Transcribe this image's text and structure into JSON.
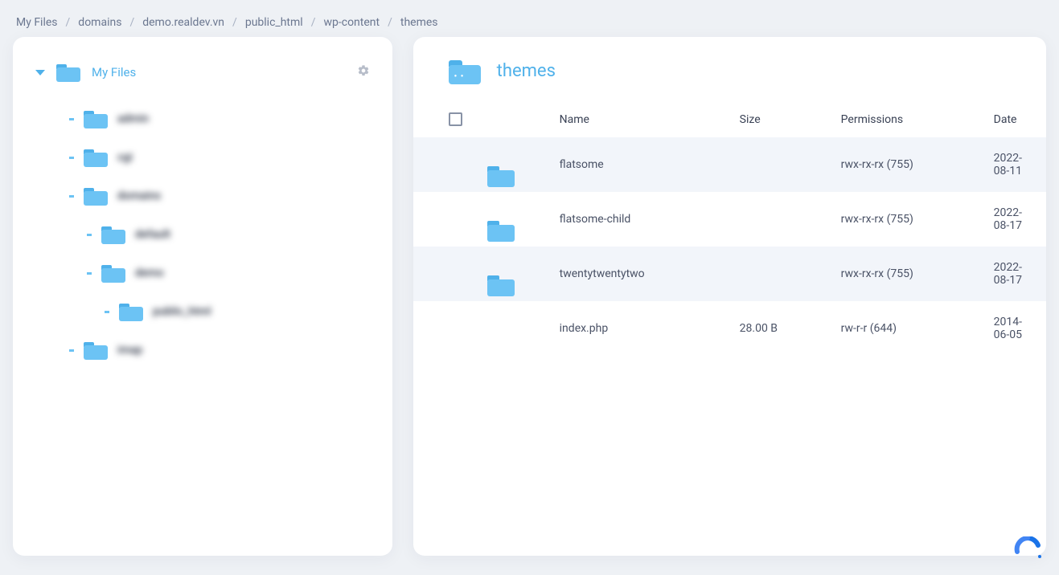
{
  "breadcrumb": [
    "My Files",
    "domains",
    "demo.realdev.vn",
    "public_html",
    "wp-content",
    "themes"
  ],
  "sidebar": {
    "root_label": "My Files",
    "items": [
      {
        "label": "admin",
        "indent": 0
      },
      {
        "label": "cgi",
        "indent": 0
      },
      {
        "label": "domains",
        "indent": 0
      },
      {
        "label": "default",
        "indent": 1
      },
      {
        "label": "demo",
        "indent": 1
      },
      {
        "label": "public_html",
        "indent": 2
      },
      {
        "label": "imap",
        "indent": 0
      }
    ]
  },
  "current": {
    "title": "themes"
  },
  "columns": {
    "name": "Name",
    "size": "Size",
    "permissions": "Permissions",
    "date": "Date"
  },
  "rows": [
    {
      "type": "folder",
      "name": "flatsome",
      "size": "",
      "perm": "rwx-rx-rx (755)",
      "date": "2022-08-11",
      "alt": true
    },
    {
      "type": "folder",
      "name": "flatsome-child",
      "size": "",
      "perm": "rwx-rx-rx (755)",
      "date": "2022-08-17",
      "alt": false
    },
    {
      "type": "folder",
      "name": "twentytwentytwo",
      "size": "",
      "perm": "rwx-rx-rx (755)",
      "date": "2022-08-17",
      "alt": true
    },
    {
      "type": "file",
      "name": "index.php",
      "size": "28.00 B",
      "perm": "rw-r-r (644)",
      "date": "2014-06-05",
      "alt": false
    }
  ]
}
